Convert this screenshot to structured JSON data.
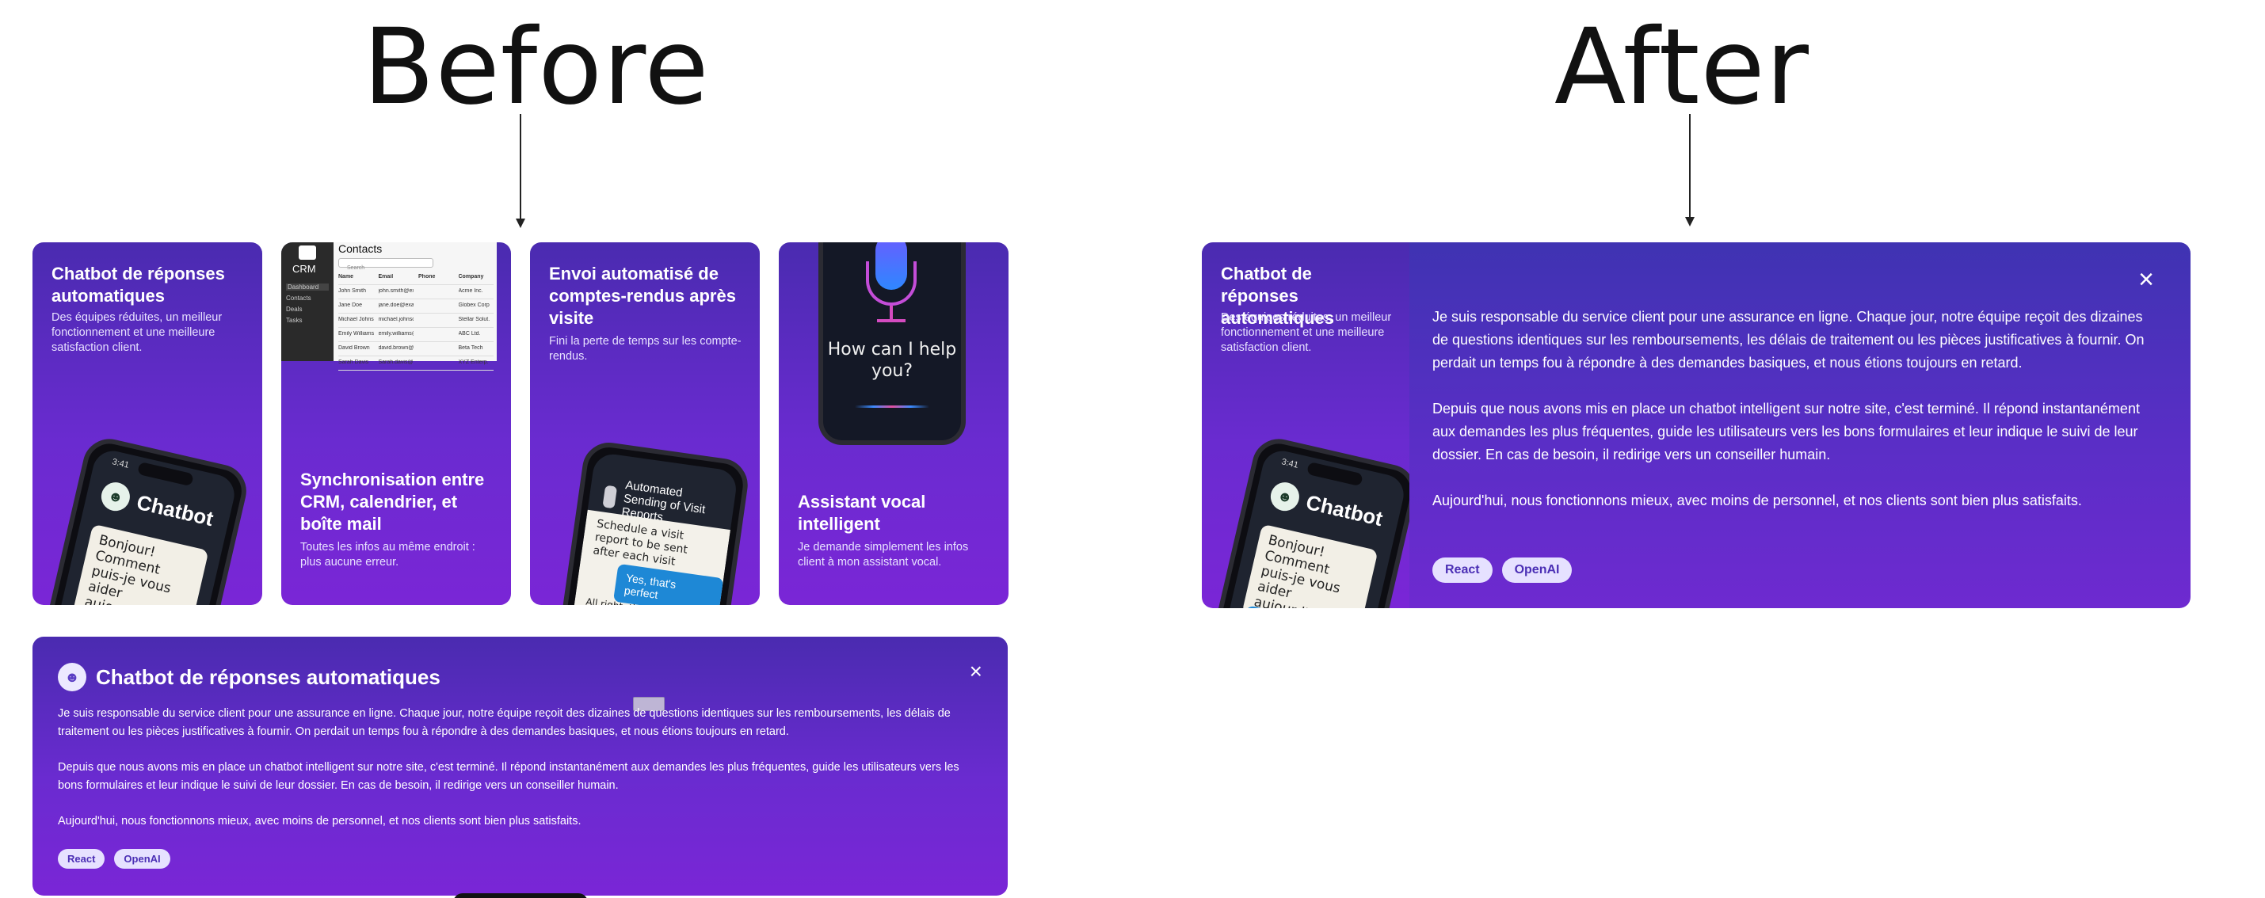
{
  "headings": {
    "before": "Before",
    "after": "After"
  },
  "cards": [
    {
      "title": "Chatbot de réponses automatiques",
      "desc": "Des équipes réduites, un meilleur fonctionnement et une meilleure satisfaction client.",
      "phone": {
        "time": "3:41",
        "bot_name": "Chatbot",
        "bubble": "Bonjour! Comment puis-je vous aider aujourd'hui?"
      }
    },
    {
      "title": "Synchronisation entre CRM, calendrier, et boîte mail",
      "desc": "Toutes les infos au même endroit : plus aucune erreur.",
      "crm": {
        "label": "CRM",
        "title": "Contacts",
        "search": "Search",
        "nav": [
          "Dashboard",
          "Contacts",
          "Deals",
          "Tasks"
        ],
        "columns": [
          "Name",
          "Email",
          "Phone",
          "Company"
        ],
        "rows": [
          [
            "John Smith",
            "john.smith@example.com",
            "",
            "Acme Inc."
          ],
          [
            "Jane Doe",
            "jane.doe@example.com",
            "",
            "Globex Corp"
          ],
          [
            "Michael Johnson",
            "michael.johnson@example.com",
            "",
            "Stellar Solut."
          ],
          [
            "Emily Williams",
            "emily.williams@example.com",
            "",
            "ABC Ltd."
          ],
          [
            "David Brown",
            "david.brown@example.com",
            "",
            "Beta Tech"
          ],
          [
            "Sarah Davis",
            "Sarah.davis@example.com",
            "",
            "XYZ Enterp."
          ]
        ]
      }
    },
    {
      "title": "Envoi automatisé de comptes-rendus après visite",
      "desc": "Fini la perte de temps sur les compte-rendus.",
      "report": {
        "header": "Automated Sending of Visit Reports",
        "msg1": "Schedule a visit report to be sent after each visit",
        "reply": "Yes, that's perfect",
        "msg2": "All right, the visit report will be automatically after each visit"
      }
    },
    {
      "title": "Assistant vocal intelligent",
      "desc": "Je demande simplement les infos client à mon assistant vocal.",
      "voice": {
        "prompt": "How can I help you?"
      }
    }
  ],
  "panel": {
    "title": "Chatbot de réponses automatiques",
    "close": "×",
    "paragraphs": [
      "Je suis responsable du service client pour une assurance en ligne. Chaque jour, notre équipe reçoit des dizaines de questions identiques sur les remboursements, les délais de traitement ou les pièces justificatives à fournir. On perdait un temps fou à répondre à des demandes basiques, et nous étions toujours en retard.",
      "Depuis que nous avons mis en place un chatbot intelligent sur notre site, c'est terminé. Il répond instantanément aux demandes les plus fréquentes, guide les utilisateurs vers les bons formulaires et leur indique le suivi de leur dossier. En cas de besoin, il redirige vers un conseiller humain.",
      "Aujourd'hui, nous fonctionnons mieux, avec moins de personnel, et nos clients sont bien plus satisfaits."
    ],
    "tags": [
      "React",
      "OpenAI"
    ]
  }
}
